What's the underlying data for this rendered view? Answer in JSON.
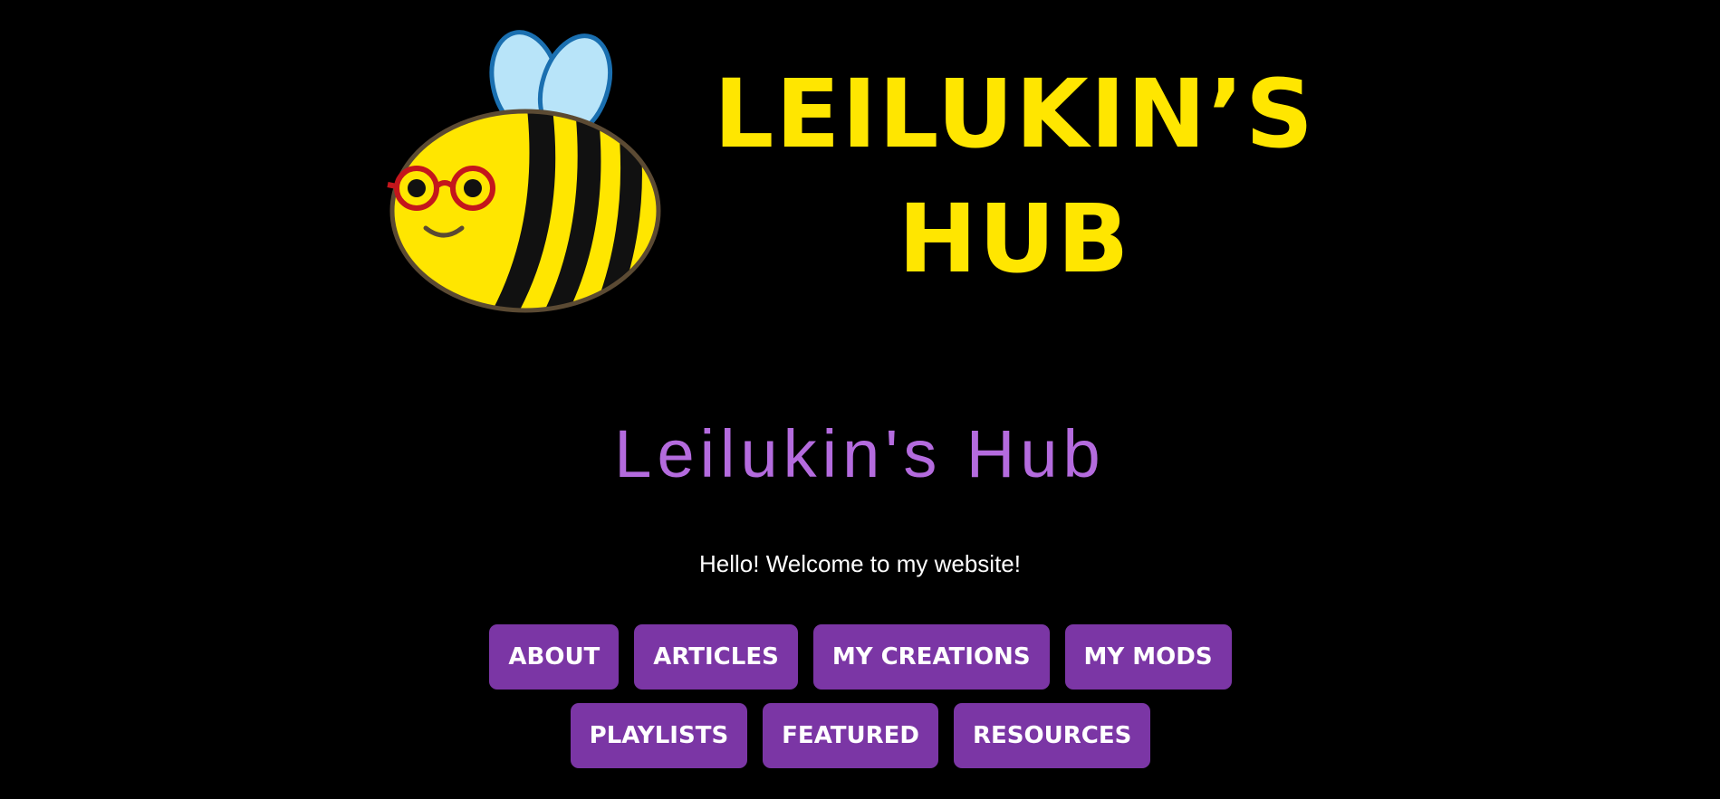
{
  "banner": {
    "logo_line1": "LEILUKIN’S",
    "logo_line2": "HUB",
    "logo_color": "#ffe600",
    "mascot": "bee-with-glasses"
  },
  "header": {
    "title": "Leilukin's Hub",
    "title_color": "#b46bde",
    "welcome": "Hello! Welcome to my website!"
  },
  "nav": {
    "button_color": "#7b36a5",
    "items": [
      {
        "label": "ABOUT"
      },
      {
        "label": "ARTICLES"
      },
      {
        "label": "MY CREATIONS"
      },
      {
        "label": "MY MODS"
      },
      {
        "label": "PLAYLISTS"
      },
      {
        "label": "FEATURED"
      },
      {
        "label": "RESOURCES"
      }
    ]
  }
}
